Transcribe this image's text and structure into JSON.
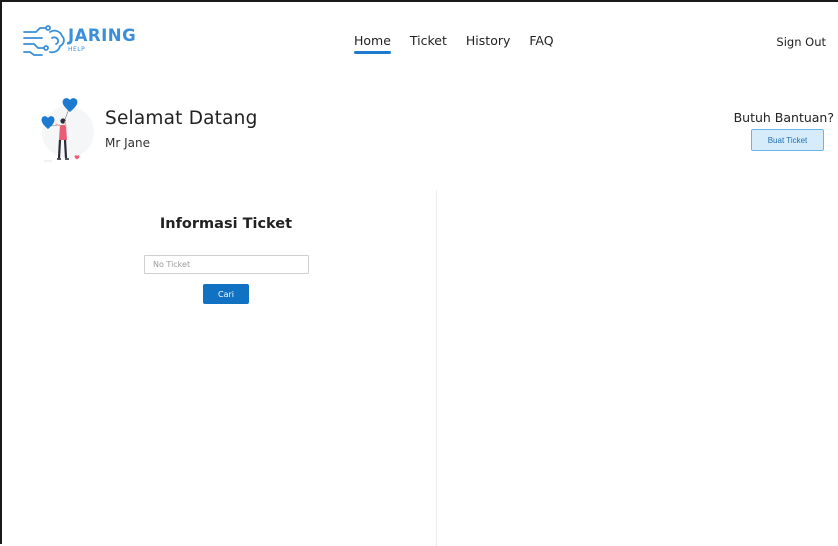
{
  "brand": {
    "name": "JARING",
    "sub": "HELP",
    "color": "#3a8fd9"
  },
  "nav": {
    "items": [
      {
        "label": "Home",
        "active": true
      },
      {
        "label": "Ticket",
        "active": false
      },
      {
        "label": "History",
        "active": false
      },
      {
        "label": "FAQ",
        "active": false
      }
    ],
    "sign_out": "Sign Out",
    "accent": "#1e7ad1"
  },
  "welcome": {
    "title": "Selamat Datang",
    "user": "Mr Jane",
    "illustration_icon": "woman-with-heart-balloons-illustration"
  },
  "help": {
    "title": "Butuh Bantuan?",
    "button_label": "Buat Ticket"
  },
  "ticket_info": {
    "title": "Informasi Ticket",
    "input_placeholder": "No Ticket",
    "input_value": "",
    "search_label": "Cari",
    "button_color": "#1172c4"
  }
}
